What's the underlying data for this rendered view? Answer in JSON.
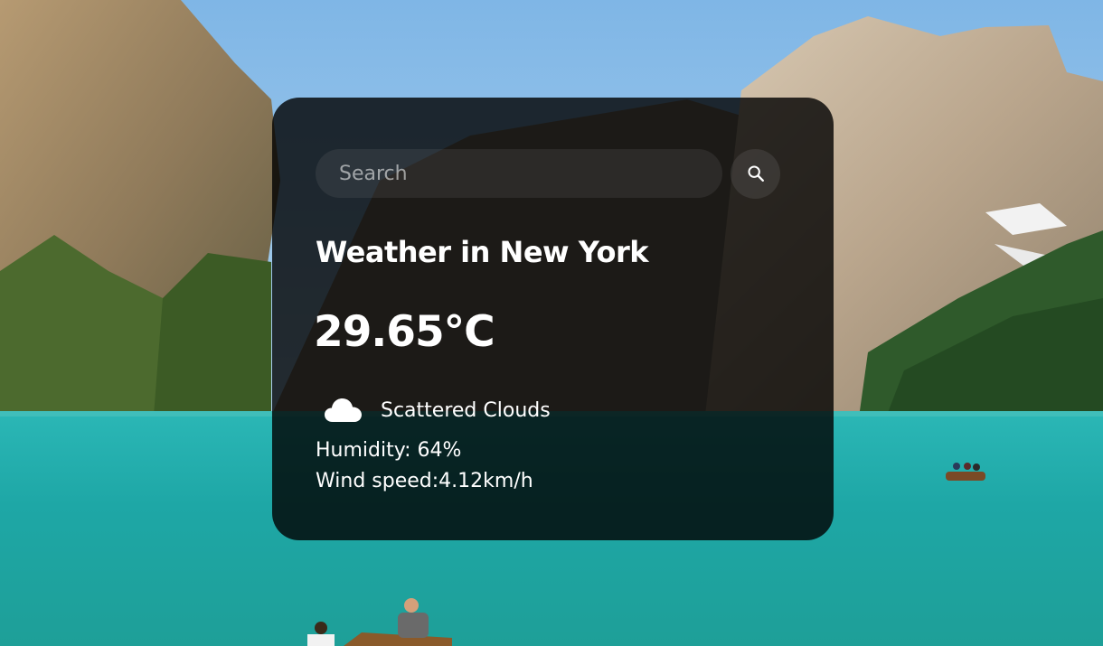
{
  "search": {
    "placeholder": "Search",
    "value": "",
    "button_icon": "search-icon"
  },
  "weather": {
    "title": "Weather in New York",
    "temperature": "29.65°C",
    "condition_icon": "cloud-icon",
    "description": "Scattered Clouds",
    "humidity": "Humidity: 64%",
    "wind": "Wind speed:4.12km/h"
  },
  "colors": {
    "card_background": "#000000cc",
    "text": "#ffffff",
    "sky": "#9cc9ea",
    "lake": "#1fb5b0"
  }
}
